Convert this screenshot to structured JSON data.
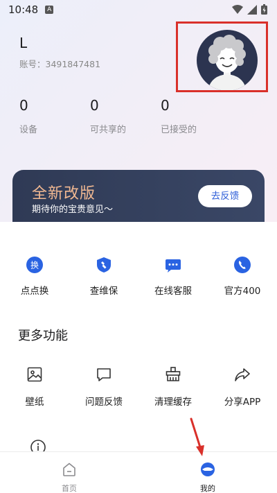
{
  "status_bar": {
    "time": "10:48",
    "badge": "A"
  },
  "profile": {
    "name": "L",
    "account": "账号：3491847481"
  },
  "stats": [
    {
      "value": "0",
      "label": "设备"
    },
    {
      "value": "0",
      "label": "可共享的"
    },
    {
      "value": "0",
      "label": "已接受的"
    }
  ],
  "banner": {
    "title": "全新改版",
    "subtitle": "期待你的宝贵意见～",
    "button": "去反馈"
  },
  "quick_actions": [
    {
      "label": "点点换",
      "icon": "swap-icon",
      "icon_text": "换"
    },
    {
      "label": "查维保",
      "icon": "warranty-icon"
    },
    {
      "label": "在线客服",
      "icon": "chat-icon"
    },
    {
      "label": "官方400",
      "icon": "phone-icon"
    }
  ],
  "more_section": {
    "title": "更多功能",
    "items": [
      {
        "label": "壁纸",
        "icon": "image-icon"
      },
      {
        "label": "问题反馈",
        "icon": "message-icon"
      },
      {
        "label": "清理缓存",
        "icon": "broom-icon"
      },
      {
        "label": "分享APP",
        "icon": "share-icon"
      }
    ]
  },
  "tabs": [
    {
      "label": "首页",
      "icon": "home-icon"
    },
    {
      "label": "我的",
      "icon": "profile-tab-icon"
    }
  ],
  "colors": {
    "accent_blue": "#2a63e2",
    "banner_bg": "#2f3a55",
    "banner_title": "#f2b992",
    "highlight_red": "#d9302a"
  }
}
